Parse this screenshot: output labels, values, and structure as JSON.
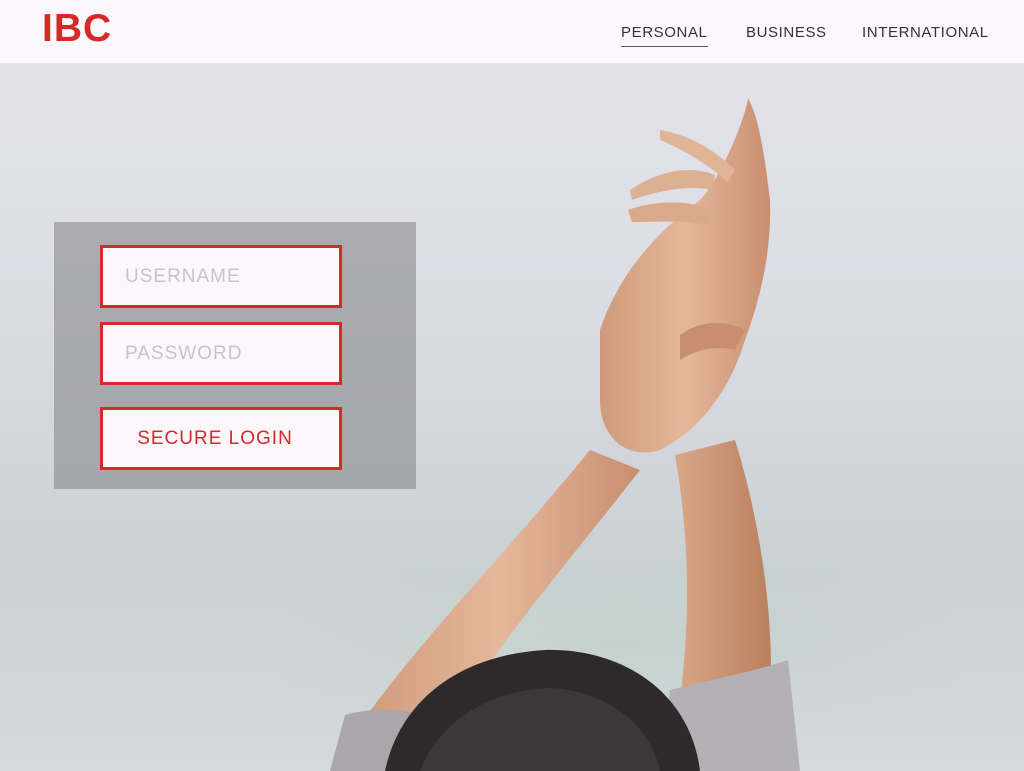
{
  "brand": {
    "logo_text": "IBC",
    "accent_color": "#d42a2a"
  },
  "nav": {
    "items": [
      {
        "label": "PERSONAL",
        "active": true
      },
      {
        "label": "BUSINESS",
        "active": false
      },
      {
        "label": "INTERNATIONAL",
        "active": false
      }
    ]
  },
  "login": {
    "username_placeholder": "USERNAME",
    "password_placeholder": "PASSWORD",
    "submit_label": "SECURE LOGIN"
  }
}
